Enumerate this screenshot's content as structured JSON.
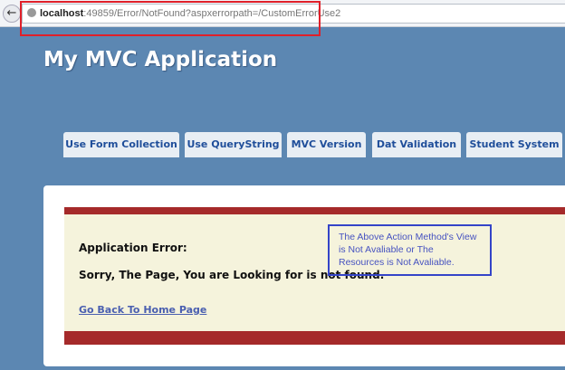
{
  "browser": {
    "url_host": "localhost",
    "url_rest": ":49859/Error/NotFound?aspxerrorpath=/CustomErrorUse2"
  },
  "header": {
    "title": "My MVC Application"
  },
  "tabs": [
    {
      "label": "Use Form Collection"
    },
    {
      "label": "Use QueryString"
    },
    {
      "label": "MVC Version"
    },
    {
      "label": "Dat Validation"
    },
    {
      "label": "Student System"
    }
  ],
  "error": {
    "heading": "Application Error:",
    "message": "Sorry, The Page, You are Looking for is not found.",
    "link": "Go Back To Home Page"
  },
  "annotation": {
    "text": "The Above Action Method's View is Not Avaliable or The Resources is Not Avaliable."
  }
}
